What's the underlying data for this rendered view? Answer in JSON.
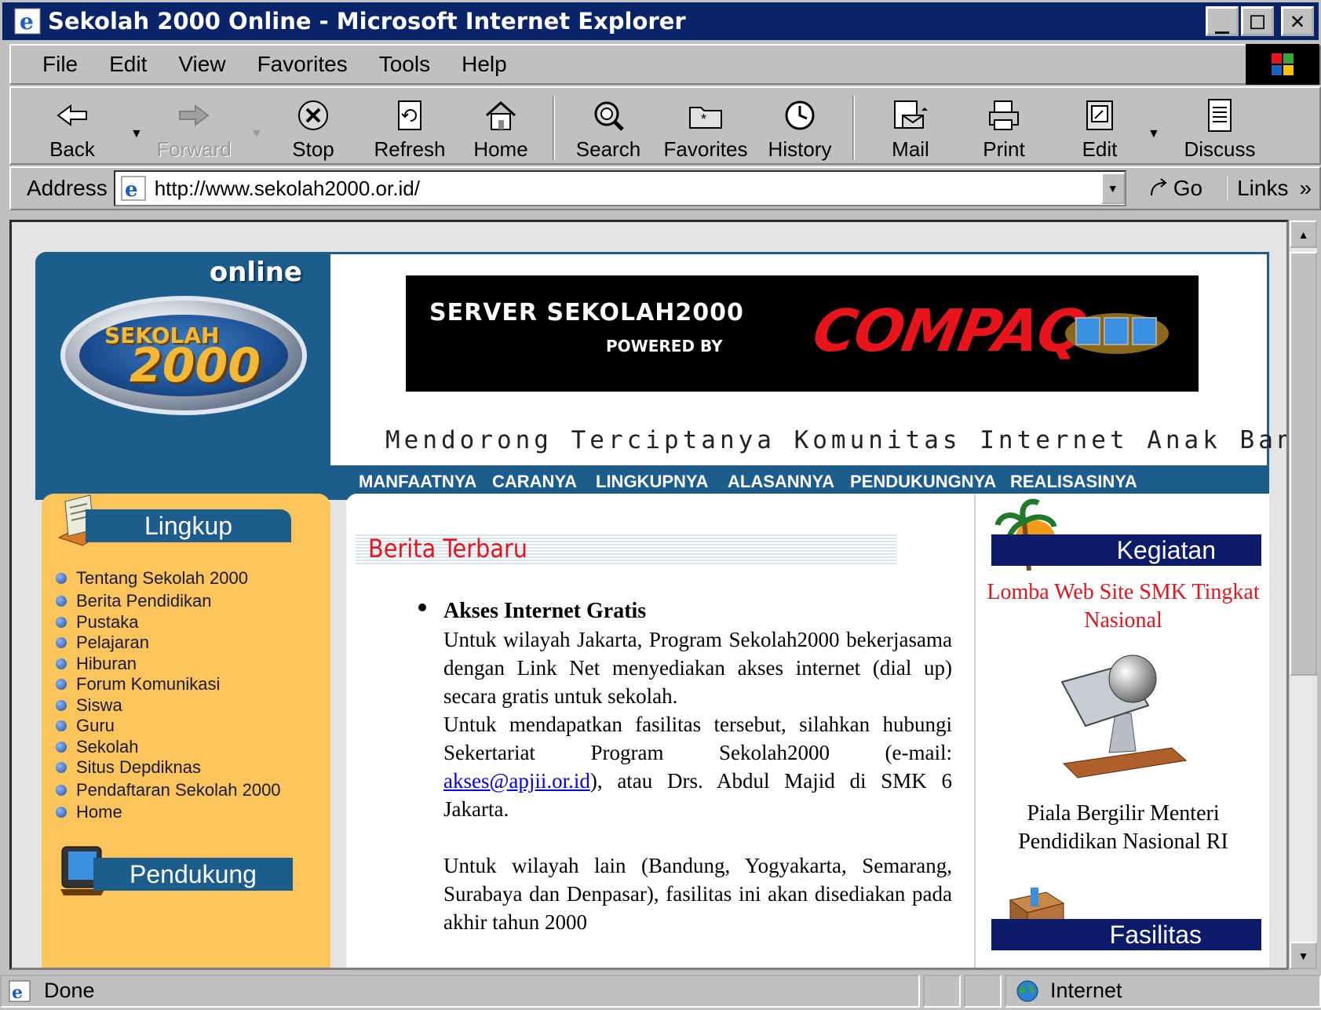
{
  "window": {
    "title": "Sekolah 2000 Online - Microsoft Internet Explorer",
    "minimize": "_",
    "maximize": "□",
    "close": "✕"
  },
  "menu": [
    {
      "label": "File"
    },
    {
      "label": "Edit"
    },
    {
      "label": "View"
    },
    {
      "label": "Favorites"
    },
    {
      "label": "Tools"
    },
    {
      "label": "Help"
    }
  ],
  "toolbar": {
    "back": "Back",
    "forward": "Forward",
    "stop": "Stop",
    "refresh": "Refresh",
    "home": "Home",
    "search": "Search",
    "favorites": "Favorites",
    "history": "History",
    "mail": "Mail",
    "print": "Print",
    "edit": "Edit",
    "discuss": "Discuss"
  },
  "address": {
    "label": "Address",
    "url": "http://www.sekolah2000.or.id/",
    "go": "Go",
    "links": "Links",
    "links_chevron": "»"
  },
  "site": {
    "logo": {
      "online": "online",
      "sekolah": "SEKOLAH",
      "year": "2000"
    },
    "banner": {
      "line1": "SERVER SEKOLAH2000",
      "line2": "POWERED BY",
      "brand": "COMPAQ"
    },
    "tagline": "Mendorong Terciptanya Komunitas Internet Anak Bangsa",
    "nav": [
      {
        "label": "MANFAATNYA"
      },
      {
        "label": "CARANYA"
      },
      {
        "label": "LINGKUPNYA"
      },
      {
        "label": "ALASANNYA"
      },
      {
        "label": "PENDUKUNGNYA"
      },
      {
        "label": "REALISASINYA"
      }
    ],
    "left": {
      "section1": "Lingkup",
      "links": [
        {
          "label": "Tentang Sekolah 2000"
        },
        {
          "label": "Berita Pendidikan"
        },
        {
          "label": "Pustaka"
        },
        {
          "label": "Pelajaran"
        },
        {
          "label": "Hiburan"
        },
        {
          "label": "Forum Komunikasi"
        },
        {
          "label": "Siswa"
        },
        {
          "label": "Guru"
        },
        {
          "label": "Sekolah"
        },
        {
          "label": "Situs Depdiknas"
        },
        {
          "label": "Pendaftaran Sekolah 2000"
        },
        {
          "label": "Home"
        }
      ],
      "section2": "Pendukung"
    },
    "news": {
      "heading": "Berita Terbaru",
      "title": "Akses Internet Gratis",
      "p1": "Untuk wilayah Jakarta, Program Sekolah2000 bekerjasama dengan Link Net menyediakan akses internet (dial up) secara gratis untuk sekolah.",
      "p2_before": "Untuk mendapatkan fasilitas tersebut, silahkan hubungi Sekertariat Program Sekolah2000 (e-mail: ",
      "email": "akses@apjii.or.id",
      "p2_after": "), atau Drs. Abdul Majid di SMK 6 Jakarta.",
      "p3": "Untuk wilayah lain (Bandung, Yogyakarta, Semarang, Surabaya dan Denpasar), fasilitas ini akan disediakan pada akhir tahun 2000"
    },
    "right": {
      "section1": "Kegiatan",
      "event_link": "Lomba Web Site SMK Tingkat Nasional",
      "trophy_caption": "Piala Bergilir Menteri Pendidikan Nasional RI",
      "section2": "Fasilitas"
    }
  },
  "status": {
    "text": "Done",
    "zone": "Internet"
  }
}
